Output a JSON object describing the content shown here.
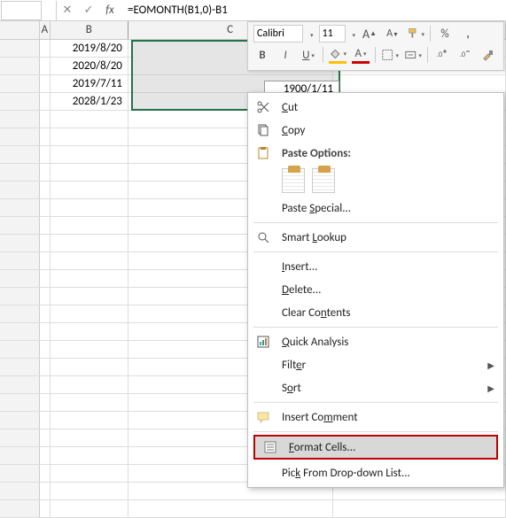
{
  "formula_bar": {
    "formula": "=EOMONTH(B1,0)-B1",
    "cancel": "✕",
    "confirm": "✓",
    "fx": "fx"
  },
  "columns": {
    "A": "A",
    "B": "B",
    "C": "C"
  },
  "rows": [
    {
      "B": "2019/8/20"
    },
    {
      "B": "2020/8/20"
    },
    {
      "B": "2019/7/11"
    },
    {
      "B": "2028/1/23"
    }
  ],
  "floating_cell": "1900/1/11",
  "mini_toolbar": {
    "font": "Calibri",
    "size": "11",
    "increase_font": "A",
    "decrease_font": "A",
    "format_painter": "",
    "percent": "%",
    "comma": ",",
    "bold": "B",
    "italic": "I",
    "underline": "U",
    "fill": "",
    "font_color": "A",
    "borders": "",
    "merge": "",
    "inc_dec": "",
    "dec_dec": ""
  },
  "context_menu": {
    "cut": "Cut",
    "copy": "Copy",
    "paste_options": "Paste Options:",
    "paste_special": "Paste Special...",
    "smart_lookup": "Smart Lookup",
    "insert": "Insert...",
    "delete": "Delete...",
    "clear_contents": "Clear Contents",
    "quick_analysis": "Quick Analysis",
    "filter": "Filter",
    "sort": "Sort",
    "insert_comment": "Insert Comment",
    "format_cells": "Format Cells...",
    "pick_dropdown": "Pick From Drop-down List..."
  }
}
